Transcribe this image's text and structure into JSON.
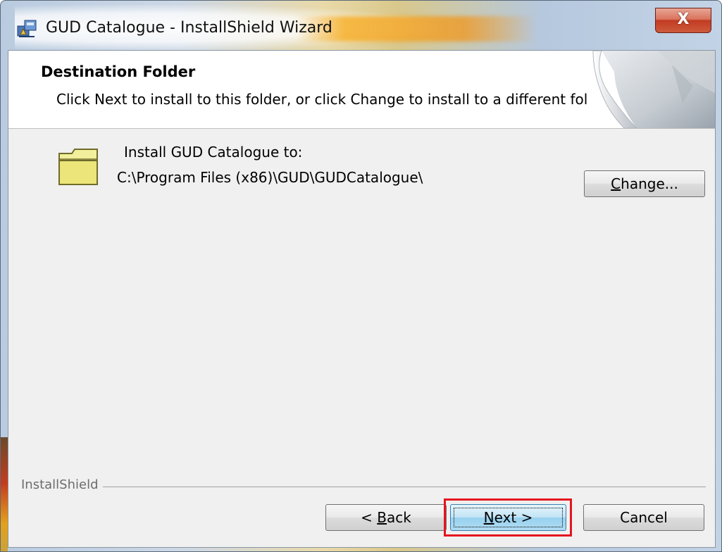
{
  "window": {
    "title": "GUD Catalogue - InstallShield Wizard",
    "close_glyph": "X"
  },
  "header": {
    "title": "Destination Folder",
    "subtitle": "Click Next to install to this folder, or click Change to install to a different folder."
  },
  "body": {
    "install_label": "Install GUD Catalogue to:",
    "install_path": "C:\\Program Files (x86)\\GUD\\GUDCatalogue\\"
  },
  "buttons": {
    "change": {
      "mnemonic": "C",
      "rest": "hange..."
    },
    "back": {
      "prefix": "< ",
      "mnemonic": "B",
      "rest": "ack"
    },
    "next": {
      "mnemonic": "N",
      "rest": "ext >"
    },
    "cancel": "Cancel"
  },
  "footer": {
    "brand": "InstallShield"
  },
  "colors": {
    "highlight": "#e4151f",
    "close_button": "#c23b22",
    "default_button": "#98d1ef"
  },
  "icons": {
    "app": "installer-icon",
    "folder": "folder-icon",
    "header_art": "page-curl-art"
  }
}
